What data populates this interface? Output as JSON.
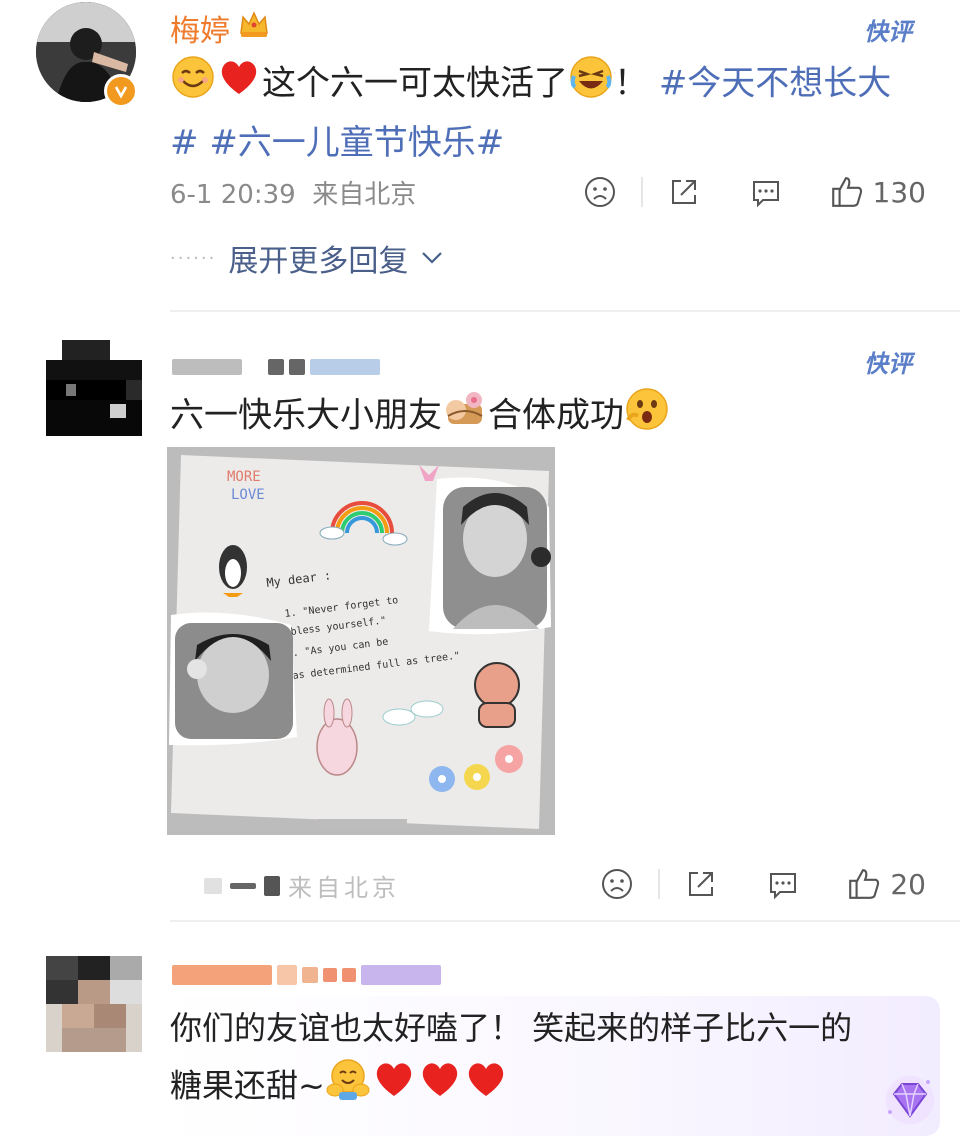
{
  "comment1": {
    "username": "梅婷",
    "crown_icon": "crown-icon",
    "quick_review": "快评",
    "text_main": "这个六一可太快活了",
    "text_bang": "！",
    "tag1": "#今天不想长大",
    "tag2": "#",
    "tag3": "#六一儿童节快乐#",
    "time": "6-1 20:39",
    "source": "来自北京",
    "likes": "130",
    "expand_label": "展开更多回复",
    "dots": "······"
  },
  "comment2": {
    "quick_review": "快评",
    "text_a": "六一快乐大小朋友",
    "text_b": "合体成功",
    "image_texts": {
      "more": "MORE",
      "love": "LOVE",
      "line1": "My dear :",
      "line2": "1. \"Never forget to",
      "line3": "bless yourself.\"",
      "line4": "2. \"As you can be",
      "line5": "as determined full as tree.\""
    },
    "source_blurred": "来自北京",
    "likes": "20"
  },
  "comment3": {
    "text_line1": "你们的友谊也太好嗑了！ 笑起来的样子比六一的",
    "text_line2": "糖果还甜~"
  },
  "colors": {
    "username": "#ef7b2d",
    "hashtag": "#4f6eb8",
    "quick_review": "#5b7ec8",
    "meta": "#8a8a8a"
  }
}
